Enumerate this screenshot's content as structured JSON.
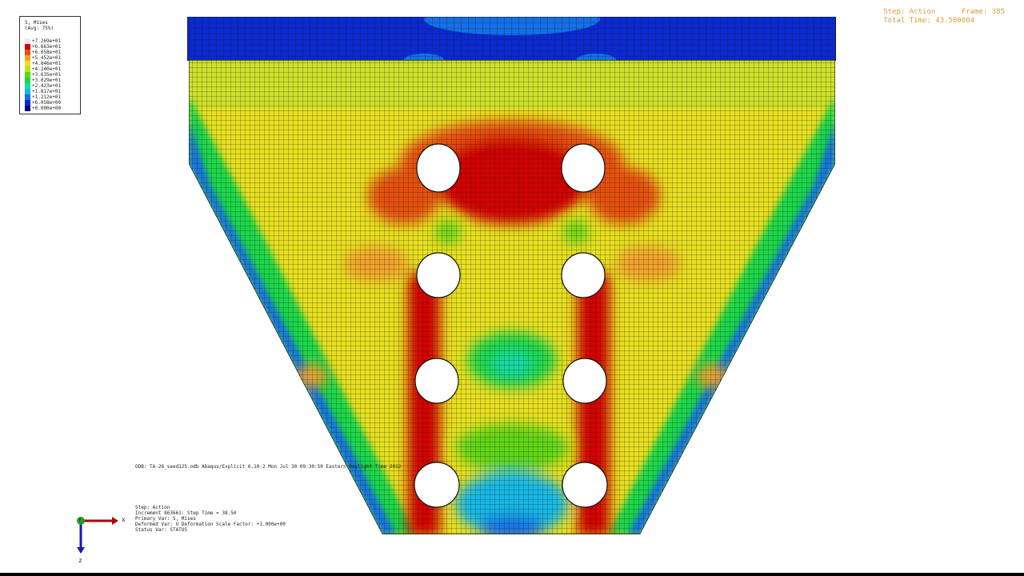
{
  "legend": {
    "title_line1": "S, Mises",
    "title_line2": "(Avg: 75%)",
    "entries": [
      {
        "label": "+7.269e+01",
        "color": "#e8e8e8"
      },
      {
        "label": "+6.663e+01",
        "color": "#d40000"
      },
      {
        "label": "+6.058e+01",
        "color": "#e64f10"
      },
      {
        "label": "+5.452e+01",
        "color": "#f2a22a"
      },
      {
        "label": "+4.846e+01",
        "color": "#e8e020"
      },
      {
        "label": "+4.240e+01",
        "color": "#b8e81a"
      },
      {
        "label": "+3.635e+01",
        "color": "#5ed618"
      },
      {
        "label": "+3.029e+01",
        "color": "#1ad84a"
      },
      {
        "label": "+2.423e+01",
        "color": "#14dca8"
      },
      {
        "label": "+1.817e+01",
        "color": "#14b8e6"
      },
      {
        "label": "+1.212e+01",
        "color": "#1470e8"
      },
      {
        "label": "+6.058e+00",
        "color": "#0a2ad0"
      },
      {
        "label": "+0.000e+00",
        "color": "#000080"
      }
    ]
  },
  "step_info": {
    "step_label": "Step: Action",
    "frame_label": "Frame: 385",
    "total_time": "Total Time: 43.500004"
  },
  "odb_line": "ODB: TA-26_seed125.odb    Abaqus/Explicit 6.10-2    Mon Jul 30 09:30:50 Eastern Daylight Time 2012",
  "status": {
    "step": "Step: Action",
    "increment": "Increment    863661: Step Time =    38.50",
    "primary_var": "Primary Var: S, Mises",
    "deformed_var": "Deformed Var: U   Deformation Scale Factor: +1.000e+00",
    "status_var": "Status Var: STATUS"
  },
  "triad": {
    "x_label": "x",
    "y_label": "Y",
    "z_label": "z"
  },
  "colors": {
    "hot": "#d40000",
    "field": "#e8e020",
    "cool": "#0a2ad0",
    "mesh": "#1a1a1a",
    "annotation": "#d89c3c"
  }
}
